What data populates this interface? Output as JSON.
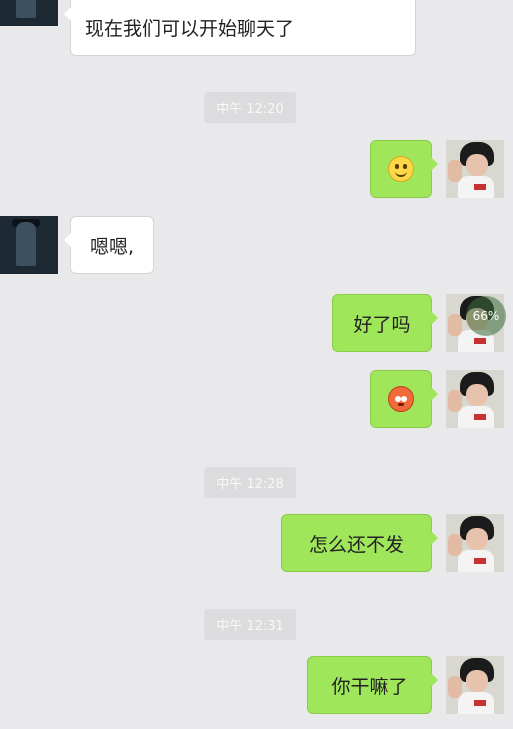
{
  "messages": [
    {
      "side": "in",
      "text": "我通过了你的朋友验证请求,现在我们可以开始聊天了",
      "text_line2": "现在我们可以开始聊天了"
    },
    {
      "side": "out",
      "emoji": "smile-emoji"
    },
    {
      "side": "in",
      "text": "嗯嗯,"
    },
    {
      "side": "out",
      "text": "好了吗",
      "upload_progress": "66%"
    },
    {
      "side": "out",
      "emoji": "angry-emoji"
    },
    {
      "side": "out",
      "text": "怎么还不发"
    },
    {
      "side": "out",
      "text": "你干嘛了"
    }
  ],
  "timestamps": [
    "中午 12:20",
    "中午 12:28",
    "中午 12:31"
  ],
  "colors": {
    "outgoing_bubble": "#9fe65a",
    "incoming_bubble": "#ffffff",
    "background": "#e9e9ec"
  }
}
